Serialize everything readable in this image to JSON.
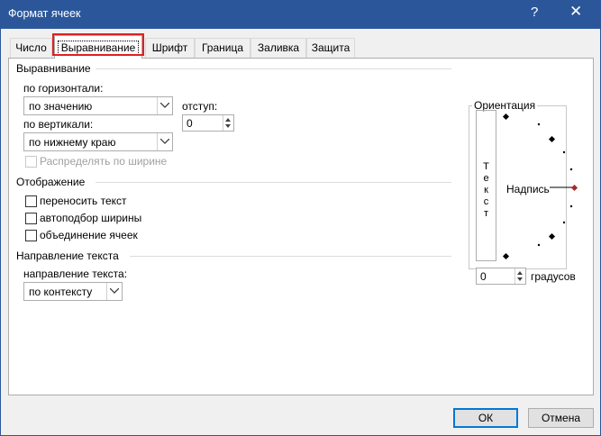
{
  "window": {
    "title": "Формат ячеек",
    "help": "?",
    "close": "✕"
  },
  "tabs": [
    {
      "label": "Число"
    },
    {
      "label": "Выравнивание"
    },
    {
      "label": "Шрифт"
    },
    {
      "label": "Граница"
    },
    {
      "label": "Заливка"
    },
    {
      "label": "Защита"
    }
  ],
  "alignment": {
    "group_label": "Выравнивание",
    "horizontal_label": "по горизонтали:",
    "horizontal_value": "по значению",
    "vertical_label": "по вертикали:",
    "vertical_value": "по нижнему краю",
    "indent_label": "отступ:",
    "indent_value": "0",
    "distribute_label": "Распределять по ширине"
  },
  "display": {
    "group_label": "Отображение",
    "wrap_label": "переносить текст",
    "shrink_label": "автоподбор ширины",
    "merge_label": "объединение ячеек"
  },
  "direction": {
    "group_label": "Направление текста",
    "direction_label": "направление текста:",
    "direction_value": "по контексту"
  },
  "orientation": {
    "group_label": "Ориентация",
    "vertical_text": "Т\nе\nк\nс\nт",
    "caption": "Надпись",
    "degrees_value": "0",
    "degrees_label": "градусов"
  },
  "footer": {
    "ok_label": "ОК",
    "cancel_label": "Отмена"
  },
  "colors": {
    "titlebar": "#2b579a",
    "highlight": "#e02020",
    "ok_border": "#0078d7",
    "orientation_marker": "#a52a2a"
  }
}
